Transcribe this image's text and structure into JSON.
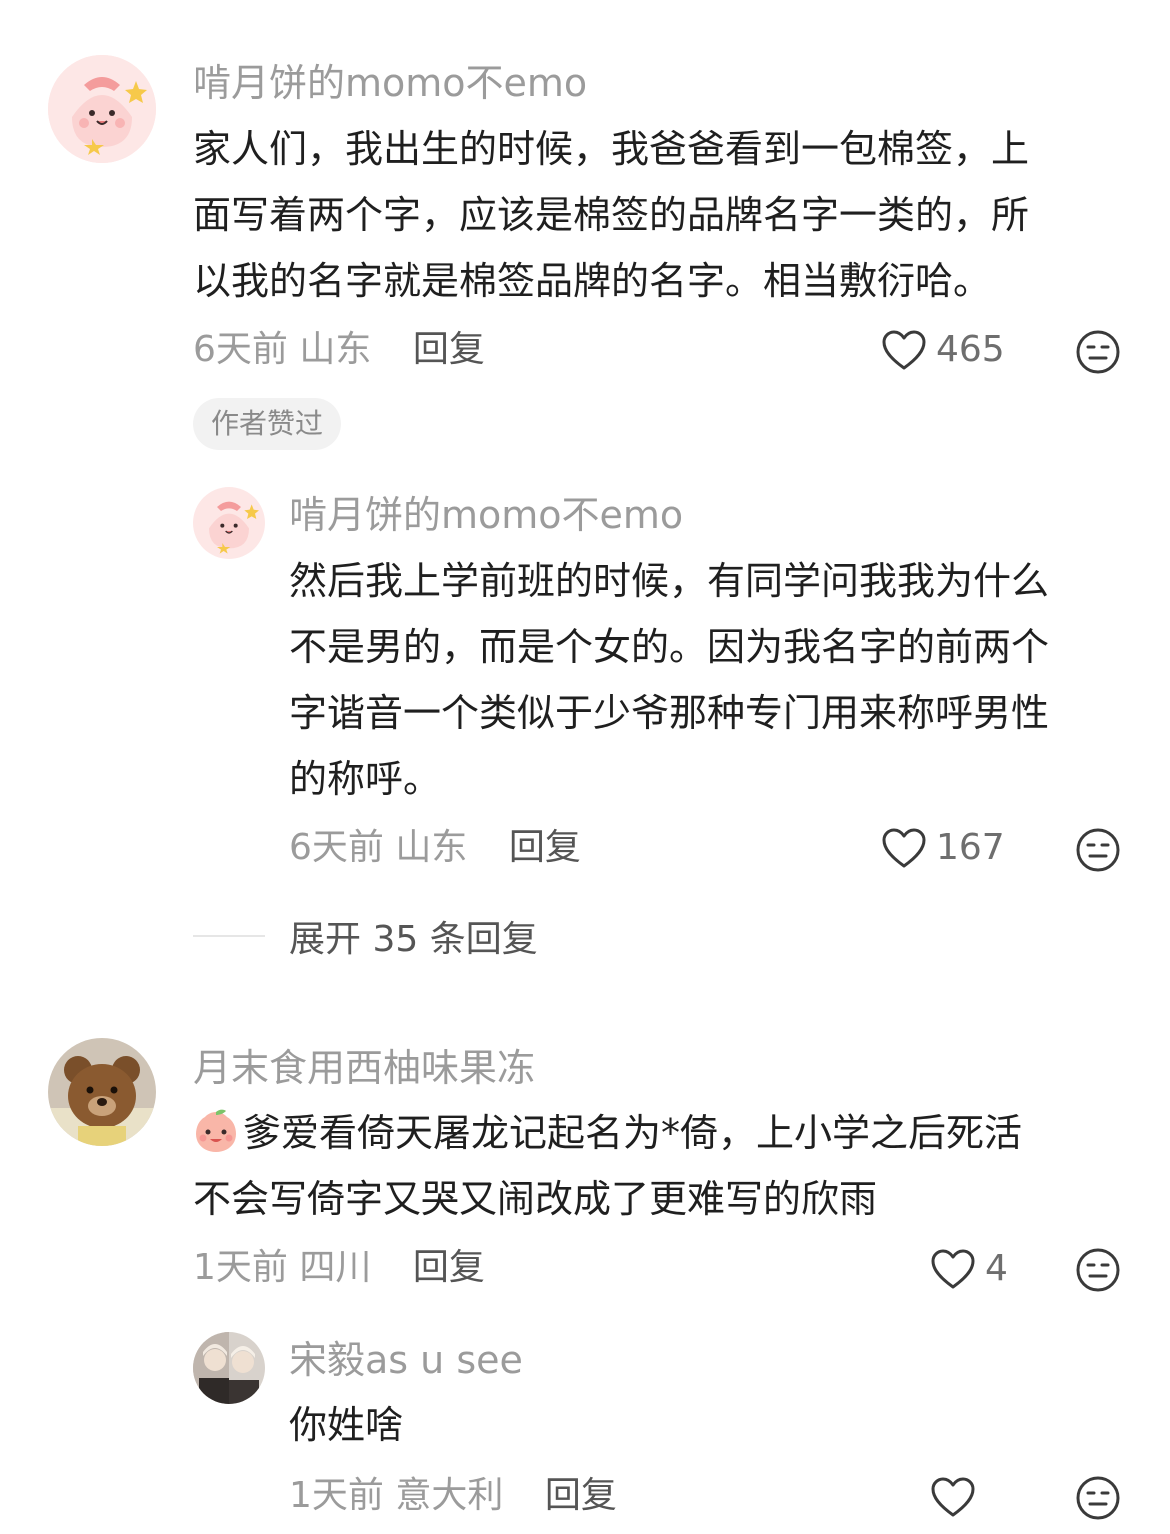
{
  "comments": [
    {
      "username": "啃月饼的momo不emo",
      "avatar_icon": "cartoon-character-avatar",
      "text_lines": [
        "家人们，我出生的时候，我爸爸看到一包棉签，上",
        "面写着两个字，应该是棉签的品牌名字一类的，所",
        "以我的名字就是棉签品牌的名字。相当敷衍哈。"
      ],
      "time": "6天前",
      "location": "山东",
      "reply_label": "回复",
      "likes": "465",
      "badge": "作者赞过",
      "replies": [
        {
          "username": "啃月饼的momo不emo",
          "avatar_icon": "cartoon-character-avatar",
          "text_lines": [
            "然后我上学前班的时候，有同学问我我为什么",
            "不是男的，而是个女的。因为我名字的前两个",
            "字谐音一个类似于少爷那种专门用来称呼男性",
            "的称呼。"
          ],
          "time": "6天前",
          "location": "山东",
          "reply_label": "回复",
          "likes": "167"
        }
      ],
      "expand_label": "展开 35 条回复"
    },
    {
      "username": "月末食用西柚味果冻",
      "avatar_icon": "teddy-bear-avatar",
      "emoji_icon": "peach-face-emoji-icon",
      "text_lines": [
        "爹爱看倚天屠龙记起名为*倚，上小学之后死活",
        "不会写倚字又哭又闹改成了更难写的欣雨"
      ],
      "time": "1天前",
      "location": "四川",
      "reply_label": "回复",
      "likes": "4",
      "replies": [
        {
          "username": "宋毅as u see",
          "avatar_icon": "photo-avatar",
          "text_lines": [
            "你姓啥"
          ],
          "time": "1天前",
          "location": "意大利",
          "reply_label": "回复",
          "likes": ""
        }
      ]
    }
  ],
  "colors": {
    "username": "#9b9b9b",
    "text": "#1f1f1f",
    "meta": "#9b9b9b",
    "reply": "#555555",
    "badge_bg": "#f2f2f2"
  },
  "icons": {
    "like": "heart-outline-icon",
    "dislike": "meh-face-icon"
  }
}
